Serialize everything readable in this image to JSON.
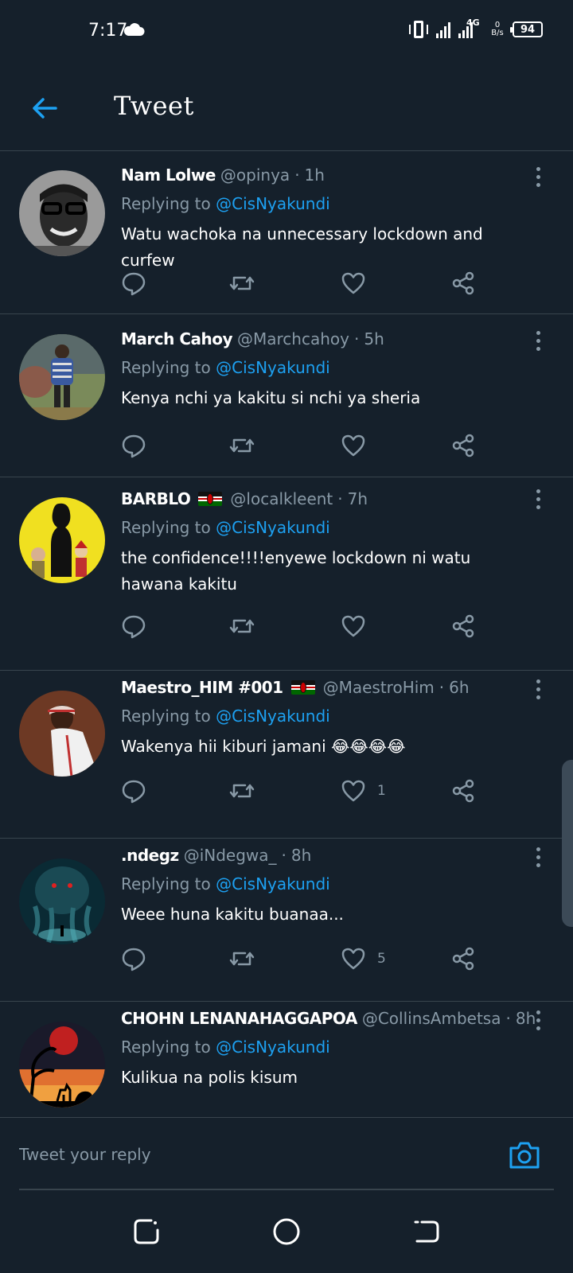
{
  "status_bar": {
    "time": "7:17",
    "network": "4G",
    "speed_top": "0",
    "speed_bottom": "B/s",
    "battery": "94"
  },
  "header": {
    "title": "Tweet"
  },
  "tweets": [
    {
      "name": "Nam Lolwe",
      "handle": "@opinya",
      "time": "1h",
      "replying_prefix": "Replying to",
      "replying_to": "@CisNyakundi",
      "text": "Watu wachoka na unnecessary lockdown and curfew",
      "like_count": ""
    },
    {
      "name": "March Cahoy",
      "handle": "@Marchcahoy",
      "time": "5h",
      "replying_prefix": "Replying to",
      "replying_to": "@CisNyakundi",
      "text": "Kenya  nchi ya kakitu si nchi ya sheria",
      "like_count": ""
    },
    {
      "name": "BARBLO",
      "handle": "@localkleent",
      "time": "7h",
      "replying_prefix": "Replying to",
      "replying_to": "@CisNyakundi",
      "text": "the confidence!!!!enyewe lockdown ni watu hawana kakitu",
      "like_count": ""
    },
    {
      "name": "Maestro_HIM #001",
      "handle": "@MaestroHim",
      "time": "6h",
      "replying_prefix": "Replying to",
      "replying_to": "@CisNyakundi",
      "text": "Wakenya hii kiburi jamani 😂😂😂😂",
      "like_count": "1"
    },
    {
      "name": ".ndegz",
      "handle": "@iNdegwa_",
      "time": "8h",
      "replying_prefix": "Replying to",
      "replying_to": "@CisNyakundi",
      "text": "Weee huna kakitu buanaa...",
      "like_count": "5"
    },
    {
      "name": "CHOHN LENANAHAGGAPOA",
      "handle": "@CollinsAmbetsa",
      "time": "8h",
      "replying_prefix": "Replying to",
      "replying_to": "@CisNyakundi",
      "text": "Kulikua na polis kisum",
      "like_count": ""
    }
  ],
  "separator": "·",
  "reply_bar": {
    "placeholder": "Tweet your reply"
  },
  "colors": {
    "background": "#15202b",
    "accent": "#1da1f2",
    "secondary_text": "#8899a6",
    "divider": "#38444d"
  }
}
